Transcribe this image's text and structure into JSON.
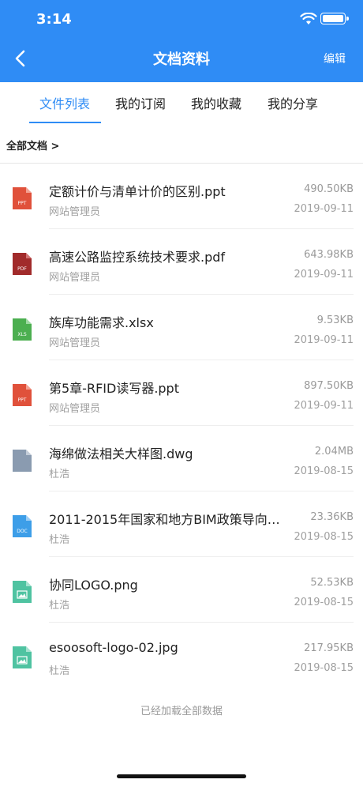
{
  "status": {
    "time": "3:14"
  },
  "nav": {
    "title": "文档资料",
    "edit_label": "编辑"
  },
  "tabs": [
    {
      "label": "文件列表",
      "active": true
    },
    {
      "label": "我的订阅",
      "active": false
    },
    {
      "label": "我的收藏",
      "active": false
    },
    {
      "label": "我的分享",
      "active": false
    }
  ],
  "breadcrumb": "全部文档  >",
  "files": [
    {
      "name": "定额计价与清单计价的区别.ppt",
      "owner": "网站管理员",
      "size": "490.50KB",
      "date": "2019-09-11",
      "type": "ppt",
      "icon_label": "PPT",
      "icon_color": "#e0513b"
    },
    {
      "name": "高速公路监控系统技术要求.pdf",
      "owner": "网站管理员",
      "size": "643.98KB",
      "date": "2019-09-11",
      "type": "pdf",
      "icon_label": "PDF",
      "icon_color": "#a12b2b"
    },
    {
      "name": "族库功能需求.xlsx",
      "owner": "网站管理员",
      "size": "9.53KB",
      "date": "2019-09-11",
      "type": "xls",
      "icon_label": "XLS",
      "icon_color": "#4caf50"
    },
    {
      "name": "第5章-RFID读写器.ppt",
      "owner": "网站管理员",
      "size": "897.50KB",
      "date": "2019-09-11",
      "type": "ppt",
      "icon_label": "PPT",
      "icon_color": "#e0513b"
    },
    {
      "name": "海绵做法相关大样图.dwg",
      "owner": "杜浩",
      "size": "2.04MB",
      "date": "2019-08-15",
      "type": "dwg",
      "icon_label": "",
      "icon_color": "#8a9bb0"
    },
    {
      "name": "2011-2015年国家和地方BIM政策导向…",
      "owner": "杜浩",
      "size": "23.36KB",
      "date": "2019-08-15",
      "type": "doc",
      "icon_label": "DOC",
      "icon_color": "#3d9ee8"
    },
    {
      "name": "协同LOGO.png",
      "owner": "杜浩",
      "size": "52.53KB",
      "date": "2019-08-15",
      "type": "image",
      "icon_label": "",
      "icon_color": "#4fc3a1"
    },
    {
      "name": "esoosoft-logo-02.jpg",
      "owner": "杜浩",
      "size": "217.95KB",
      "date": "2019-08-15",
      "type": "image",
      "icon_label": "",
      "icon_color": "#4fc3a1"
    }
  ],
  "footer": {
    "load_all": "已经加载全部数据"
  },
  "colors": {
    "primary": "#2f8cf5"
  }
}
